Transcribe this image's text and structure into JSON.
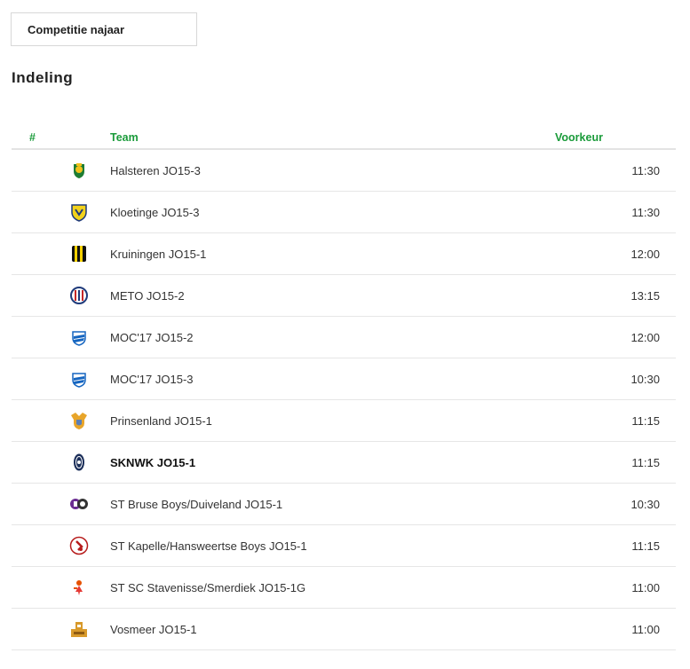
{
  "competition_selector": {
    "label": "Competitie najaar"
  },
  "section_title": "Indeling",
  "table": {
    "headers": {
      "number": "#",
      "team": "Team",
      "preference": "Voorkeur"
    },
    "rows": [
      {
        "team": "Halsteren JO15-3",
        "time": "11:30",
        "logo": "halsteren-crest"
      },
      {
        "team": "Kloetinge JO15-3",
        "time": "11:30",
        "logo": "kloetinge-crest"
      },
      {
        "team": "Kruiningen JO15-1",
        "time": "12:00",
        "logo": "kruiningen-crest"
      },
      {
        "team": "METO JO15-2",
        "time": "13:15",
        "logo": "meto-crest"
      },
      {
        "team": "MOC'17 JO15-2",
        "time": "12:00",
        "logo": "moc17-crest"
      },
      {
        "team": "MOC'17 JO15-3",
        "time": "10:30",
        "logo": "moc17-crest"
      },
      {
        "team": "Prinsenland JO15-1",
        "time": "11:15",
        "logo": "prinsenland-crest"
      },
      {
        "team": "SKNWK JO15-1",
        "time": "11:15",
        "logo": "sknwk-crest",
        "own_team": true
      },
      {
        "team": "ST Bruse Boys/Duiveland JO15-1",
        "time": "10:30",
        "logo": "st-bruse-boys-duiveland-crest"
      },
      {
        "team": "ST Kapelle/Hansweertse Boys JO15-1",
        "time": "11:15",
        "logo": "st-kapelle-hansweertse-crest"
      },
      {
        "team": "ST SC Stavenisse/Smerdiek JO15-1G",
        "time": "11:00",
        "logo": "st-stavenisse-smerdiek-crest"
      },
      {
        "team": "Vosmeer JO15-1",
        "time": "11:00",
        "logo": "vosmeer-crest"
      }
    ]
  },
  "colors": {
    "header_green": "#1a9b3a",
    "divider": "#e6e6e6",
    "text": "#333333"
  }
}
